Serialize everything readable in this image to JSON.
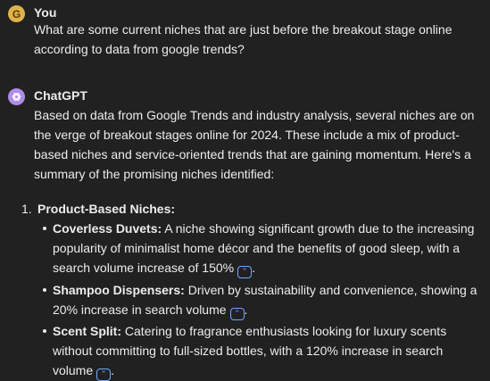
{
  "user_message": {
    "author": "You",
    "avatar_letter": "G",
    "text": "What are some current niches that are just before the breakout stage online according to data from google trends?"
  },
  "assistant_message": {
    "author": "ChatGPT",
    "intro": "Based on data from Google Trends and industry analysis, several niches are on the verge of breakout stages online for 2024. These include a mix of product-based niches and service-oriented trends that are gaining momentum. Here's a summary of the promising niches identified:",
    "list": {
      "number": "1.",
      "heading": "Product-Based Niches:",
      "items": [
        {
          "title": "Coverless Duvets:",
          "text": " A niche showing significant growth due to the increasing popularity of minimalist home décor and the benefits of good sleep, with a search volume increase of 150%",
          "period": "."
        },
        {
          "title": "Shampoo Dispensers:",
          "text": " Driven by sustainability and convenience, showing a 20% increase in search volume",
          "period": "."
        },
        {
          "title": "Scent Split:",
          "text": " Catering to fragrance enthusiasts looking for luxury scents without committing to full-sized bottles, with a 120% increase in search volume",
          "period": "."
        }
      ]
    },
    "citation_glyph": "”"
  },
  "colors": {
    "background": "#212121",
    "text": "#ececec",
    "citation": "#6ea8ff",
    "user_avatar": "#e0b24a",
    "assistant_avatar": "#b08ce8"
  }
}
